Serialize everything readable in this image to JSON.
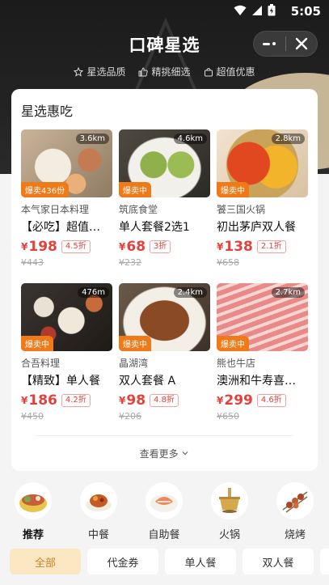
{
  "status_bar": {
    "time": "5:05"
  },
  "header": {
    "title": "口碑星选",
    "tags": [
      "星选品质",
      "精挑细选",
      "超值优惠"
    ]
  },
  "section": {
    "title": "星选惠吃",
    "see_more": "查看更多"
  },
  "items": [
    {
      "distance": "3.6km",
      "badge": "爆卖436份",
      "shop": "本气家日本料理",
      "name": "【必吃】超值…",
      "yen": "¥",
      "price": "198",
      "discount": "4.5折",
      "original": "¥443"
    },
    {
      "distance": "4.6km",
      "badge": "爆卖中",
      "shop": "筑底食堂",
      "name": "单人套餐2选1",
      "yen": "¥",
      "price": "68",
      "discount": "3折",
      "original": "¥232"
    },
    {
      "distance": "2.8km",
      "badge": "爆卖中",
      "shop": "饕三国火锅",
      "name": "初出茅庐双人餐",
      "yen": "¥",
      "price": "138",
      "discount": "2.1折",
      "original": "¥658"
    },
    {
      "distance": "476m",
      "badge": "爆卖中",
      "shop": "合吾料理",
      "name": "【精致】单人餐",
      "yen": "¥",
      "price": "186",
      "discount": "4.2折",
      "original": "¥450"
    },
    {
      "distance": "2.4km",
      "badge": "爆卖中",
      "shop": "晶湖湾",
      "name": "双人套餐 A",
      "yen": "¥",
      "price": "98",
      "discount": "4.8折",
      "original": "¥206"
    },
    {
      "distance": "2.7km",
      "badge": "爆卖中",
      "shop": "熊也牛店",
      "name": "澳洲和牛寿喜…",
      "yen": "¥",
      "price": "299",
      "discount": "4.6折",
      "original": "¥650"
    }
  ],
  "categories": [
    "推荐",
    "中餐",
    "自助餐",
    "火锅",
    "烧烤"
  ],
  "chips": [
    "全部",
    "代金券",
    "单人餐",
    "双人餐"
  ],
  "colors": {
    "accent_red": "#e2423b",
    "badge_orange": "#f07a18",
    "chip_active_bg": "#fbe7c2",
    "chip_active_text": "#c9832a"
  }
}
